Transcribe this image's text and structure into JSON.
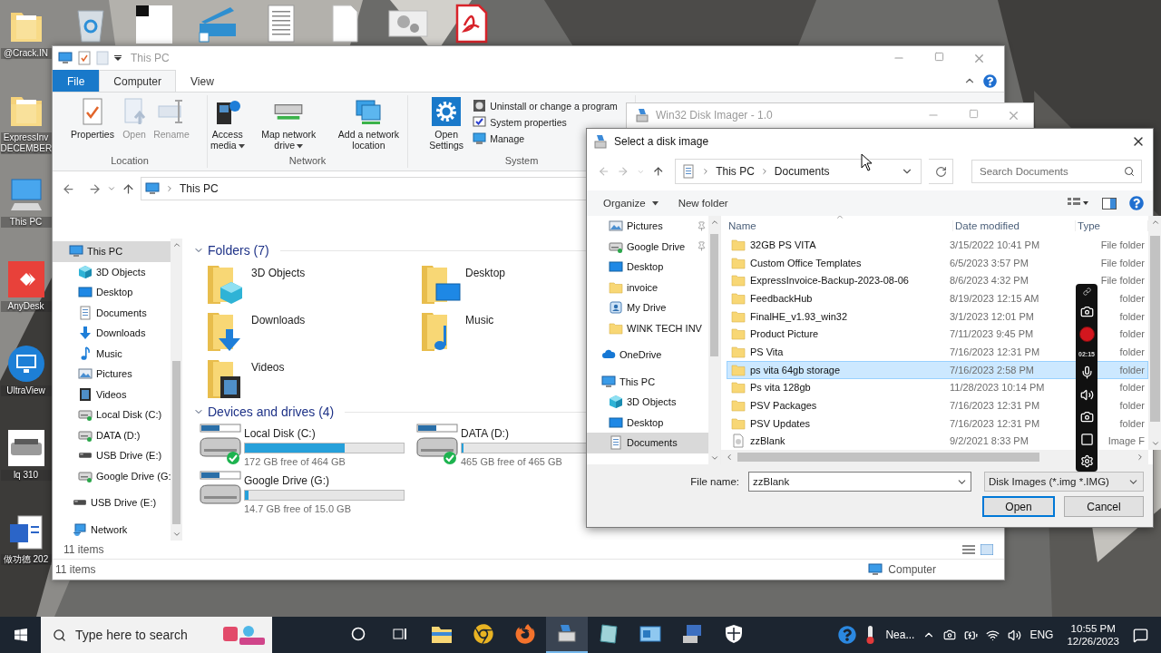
{
  "desktop": {
    "icons": [
      {
        "label": "@Crack.IN",
        "kind": "folder"
      },
      {
        "label": "ExpressInv DECEMBER",
        "kind": "folder"
      },
      {
        "label": "This PC",
        "kind": "pc"
      },
      {
        "label": "AnyDesk",
        "kind": "anydesk"
      },
      {
        "label": "UltraView",
        "kind": "ultraviewer"
      },
      {
        "label": "lq 310",
        "kind": "printer"
      },
      {
        "label": "做功德 202",
        "kind": "word"
      }
    ]
  },
  "explorer": {
    "title": "This PC",
    "tabs": [
      {
        "label": "File",
        "kind": "file",
        "selected": false
      },
      {
        "label": "Computer",
        "kind": "tab",
        "selected": true
      },
      {
        "label": "View",
        "kind": "tab",
        "selected": false
      }
    ],
    "ribbon": [
      {
        "label": "Location",
        "buttons": [
          {
            "label": "Properties",
            "kind": "properties",
            "disabled": false,
            "dropdown": false
          },
          {
            "label": "Open",
            "kind": "open",
            "disabled": true,
            "dropdown": false
          },
          {
            "label": "Rename",
            "kind": "rename",
            "disabled": true,
            "dropdown": false
          }
        ]
      },
      {
        "label": "Network",
        "buttons": [
          {
            "label": "Access media",
            "kind": "media",
            "disabled": false,
            "dropdown": true
          },
          {
            "label": "Map network drive",
            "kind": "map-drive",
            "disabled": false,
            "dropdown": true
          },
          {
            "label": "Add a network location",
            "kind": "net-location",
            "disabled": false,
            "dropdown": false
          }
        ]
      },
      {
        "label": "System",
        "buttons": [
          {
            "label": "Open Settings",
            "kind": "settings",
            "disabled": false,
            "dropdown": false
          }
        ],
        "small_buttons": [
          {
            "label": "Uninstall or change a program",
            "kind": "uninstall"
          },
          {
            "label": "System properties",
            "kind": "sysprops"
          },
          {
            "label": "Manage",
            "kind": "manage"
          }
        ]
      }
    ],
    "address": [
      "This PC"
    ],
    "nav": [
      {
        "label": "This PC",
        "kind": "pc",
        "selected": true,
        "children": [
          {
            "label": "3D Objects",
            "kind": "cube",
            "selected": false
          },
          {
            "label": "Desktop",
            "kind": "desktop",
            "selected": false
          },
          {
            "label": "Documents",
            "kind": "documents",
            "selected": false
          },
          {
            "label": "Downloads",
            "kind": "downloads",
            "selected": false
          },
          {
            "label": "Music",
            "kind": "music",
            "selected": false
          },
          {
            "label": "Pictures",
            "kind": "pictures",
            "selected": false
          },
          {
            "label": "Videos",
            "kind": "videos",
            "selected": false
          },
          {
            "label": "Local Disk (C:)",
            "kind": "disk",
            "selected": false
          },
          {
            "label": "DATA (D:)",
            "kind": "disk",
            "selected": false
          },
          {
            "label": "USB Drive (E:)",
            "kind": "usb",
            "selected": false
          },
          {
            "label": "Google Drive (G:",
            "kind": "disk",
            "selected": false
          }
        ]
      },
      {
        "label": "USB Drive (E:)",
        "kind": "usb",
        "selected": false
      },
      {
        "label": "Network",
        "kind": "network",
        "selected": false
      }
    ],
    "folders": {
      "title": "Folders (7)",
      "items": [
        {
          "label": "3D Objects",
          "kind": "cube"
        },
        {
          "label": "Desktop",
          "kind": "desktop"
        },
        {
          "label": "Downloads",
          "kind": "downloads"
        },
        {
          "label": "Music",
          "kind": "music"
        },
        {
          "label": "Videos",
          "kind": "videos"
        }
      ]
    },
    "drives": {
      "title": "Devices and drives (4)",
      "items": [
        {
          "label": "Local Disk (C:)",
          "kind": "local",
          "level": 0.63,
          "free": "172 GB free of 464 GB"
        },
        {
          "label": "DATA (D:)",
          "kind": "local",
          "level": 0.01,
          "free": "465 GB free of 465 GB"
        },
        {
          "label": "Google Drive (G:)",
          "kind": "cloud",
          "level": 0.02,
          "free": "14.7 GB free of 15.0 GB"
        }
      ]
    },
    "pane_footer": "11 items",
    "status": "11 items",
    "status_right": "Computer"
  },
  "disk_imager": {
    "title": "Win32 Disk Imager - 1.0"
  },
  "dialog": {
    "title": "Select a disk image",
    "path": [
      "This PC",
      "Documents"
    ],
    "search_placeholder": "Search Documents",
    "toolbar": [
      {
        "label": "Organize",
        "dropdown": true
      },
      {
        "label": "New folder",
        "dropdown": false
      }
    ],
    "quick_access": [
      {
        "label": "Pictures",
        "kind": "pictures",
        "pinned": true,
        "selected": false
      },
      {
        "label": "Google Drive",
        "kind": "disk",
        "pinned": true,
        "selected": false
      },
      {
        "label": "Desktop",
        "kind": "desktop",
        "pinned": false,
        "selected": false
      },
      {
        "label": "invoice",
        "kind": "folder",
        "pinned": false,
        "selected": false
      },
      {
        "label": "My Drive",
        "kind": "mydrive",
        "pinned": false,
        "selected": false
      },
      {
        "label": "WINK TECH INV",
        "kind": "folder",
        "pinned": false,
        "selected": false
      }
    ],
    "nav": [
      {
        "label": "OneDrive",
        "kind": "cloud",
        "selected": false
      },
      {
        "label": "This PC",
        "kind": "pc",
        "selected": false,
        "children": [
          {
            "label": "3D Objects",
            "kind": "cube",
            "selected": false
          },
          {
            "label": "Desktop",
            "kind": "desktop",
            "selected": false
          },
          {
            "label": "Documents",
            "kind": "documents",
            "selected": true
          }
        ]
      }
    ],
    "columns": [
      "Name",
      "Date modified",
      "Type"
    ],
    "rows": [
      {
        "name": "32GB PS VITA",
        "date": "3/15/2022 10:41 PM",
        "type": "File folder",
        "kind": "folder",
        "selected": false
      },
      {
        "name": "Custom Office Templates",
        "date": "6/5/2023 3:57 PM",
        "type": "File folder",
        "kind": "folder",
        "selected": false
      },
      {
        "name": "ExpressInvoice-Backup-2023-08-06",
        "date": "8/6/2023 4:32 PM",
        "type": "File folder",
        "kind": "folder",
        "selected": false
      },
      {
        "name": "FeedbackHub",
        "date": "8/19/2023 12:15 AM",
        "type": "folder",
        "kind": "folder",
        "selected": false
      },
      {
        "name": "FinalHE_v1.93_win32",
        "date": "3/1/2023 12:01 PM",
        "type": "folder",
        "kind": "folder",
        "selected": false
      },
      {
        "name": "Product Picture",
        "date": "7/11/2023 9:45 PM",
        "type": "folder",
        "kind": "folder",
        "selected": false
      },
      {
        "name": "PS Vita",
        "date": "7/16/2023 12:31 PM",
        "type": "folder",
        "kind": "folder",
        "selected": false
      },
      {
        "name": "ps vita 64gb storage",
        "date": "7/16/2023 2:58 PM",
        "type": "folder",
        "kind": "folder",
        "selected": true
      },
      {
        "name": "Ps vita 128gb",
        "date": "11/28/2023 10:14 PM",
        "type": "folder",
        "kind": "folder",
        "selected": false
      },
      {
        "name": "PSV Packages",
        "date": "7/16/2023 12:31 PM",
        "type": "folder",
        "kind": "folder",
        "selected": false
      },
      {
        "name": "PSV Updates",
        "date": "7/16/2023 12:31 PM",
        "type": "folder",
        "kind": "folder",
        "selected": false
      },
      {
        "name": "zzBlank",
        "date": "9/2/2021 8:33 PM",
        "type": "Image F",
        "kind": "file",
        "selected": false
      }
    ],
    "file_name_label": "File name:",
    "file_name": "zzBlank",
    "filter": "Disk Images (*.img *.IMG)",
    "buttons": [
      {
        "label": "Open",
        "default": true
      },
      {
        "label": "Cancel",
        "default": false
      }
    ]
  },
  "recorder": {
    "time": "02:15"
  },
  "taskbar": {
    "search_placeholder": "Type here to search",
    "weather": "Nea...",
    "language": "ENG",
    "time": "10:55 PM",
    "date": "12/26/2023"
  }
}
